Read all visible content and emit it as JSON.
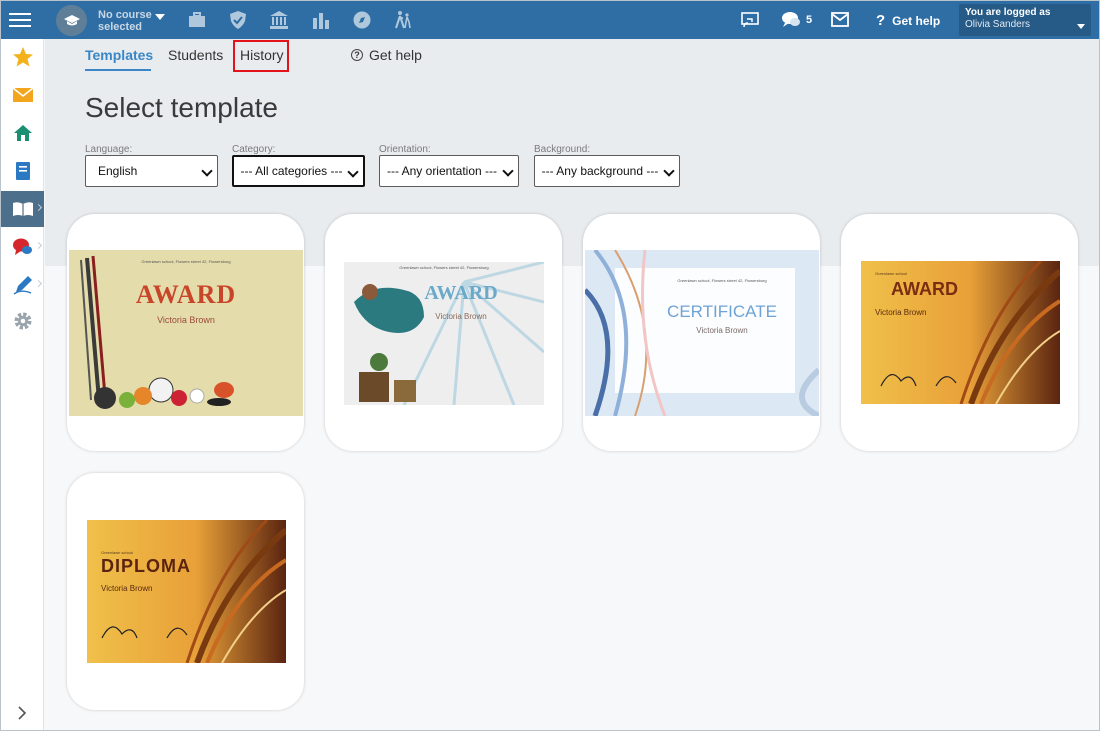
{
  "topbar": {
    "course_line1": "No course",
    "course_line2": "selected",
    "chat_count": "5",
    "get_help": "Get help",
    "login_label": "You are logged as",
    "login_name": "Olivia Sanders"
  },
  "tabs": {
    "templates": "Templates",
    "students": "Students",
    "history": "History",
    "get_help": "Get help"
  },
  "title": "Select template",
  "filters": {
    "language_label": "Language:",
    "language_value": "English",
    "category_label": "Category:",
    "category_value": "--- All categories ---",
    "orientation_label": "Orientation:",
    "orientation_value": "--- Any orientation ---",
    "background_label": "Background:",
    "background_value": "--- Any background ---"
  },
  "cards": [
    {
      "heading": "AWARD",
      "name": "Victoria Brown",
      "school": "Greenlawn school, Flowers street 42, Flowersburg",
      "accent": "#c8452a"
    },
    {
      "heading": "AWARD",
      "name": "Victoria Brown",
      "school": "Greenlawn school, Flowers street 42, Flowersburg",
      "accent": "#6aa9c9"
    },
    {
      "heading": "CERTIFICATE",
      "name": "Victoria Brown",
      "school": "Greenlawn school, Flowers street 42, Flowersburg",
      "accent": "#6fa2d6"
    },
    {
      "heading": "AWARD",
      "name": "Victoria Brown",
      "school": "Greenlawn school",
      "accent": "#7a2d10"
    },
    {
      "heading": "DIPLOMA",
      "name": "Victoria Brown",
      "school": "Greenlawn school",
      "accent": "#5a2410"
    }
  ]
}
